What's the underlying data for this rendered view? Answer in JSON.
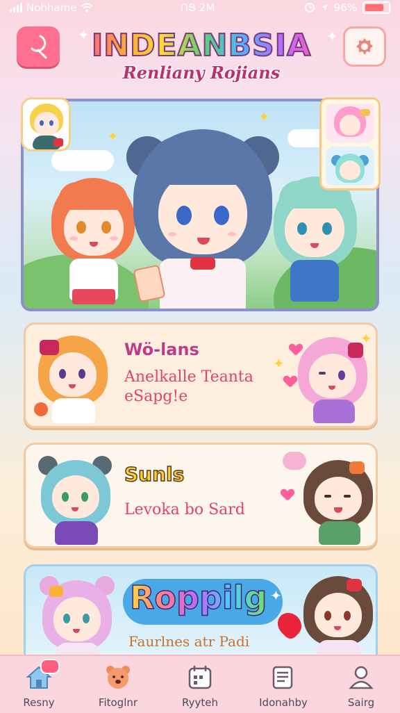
{
  "status_bar": {
    "carrier": "Nohhame",
    "time": "ՈՑ 2M",
    "battery": "96%",
    "icons": [
      "signal-bars-icon",
      "wifi-icon",
      "clock-icon",
      "location-arrow-icon",
      "battery-icon"
    ]
  },
  "header": {
    "title": "INDEANBSIA",
    "subtitle": "Renliany Rojians",
    "left_button_icon": "search-icon",
    "right_button_icon": "settings-icon"
  },
  "cards": [
    {
      "title": "Wö-lans",
      "desc": "Anelkalle Teanta eSapg!e"
    },
    {
      "title": "Sunls",
      "desc": "Levoka bo Sard"
    },
    {
      "title": "Roppilg",
      "desc": "Faurlnes atr Padi"
    }
  ],
  "nav": {
    "items": [
      {
        "label": "Resny",
        "icon": "home-icon"
      },
      {
        "label": "Fitoglnr",
        "icon": "bear-face-icon"
      },
      {
        "label": "Ryyteh",
        "icon": "calendar-icon"
      },
      {
        "label": "Idonahby",
        "icon": "notes-icon"
      },
      {
        "label": "Sairg",
        "icon": "profile-icon"
      }
    ]
  },
  "colors": {
    "accent_pink": "#ff6f8f",
    "nav_bg": "#fcd6de",
    "card_border": "#f1c9a4",
    "title_purple": "#c03a86"
  }
}
